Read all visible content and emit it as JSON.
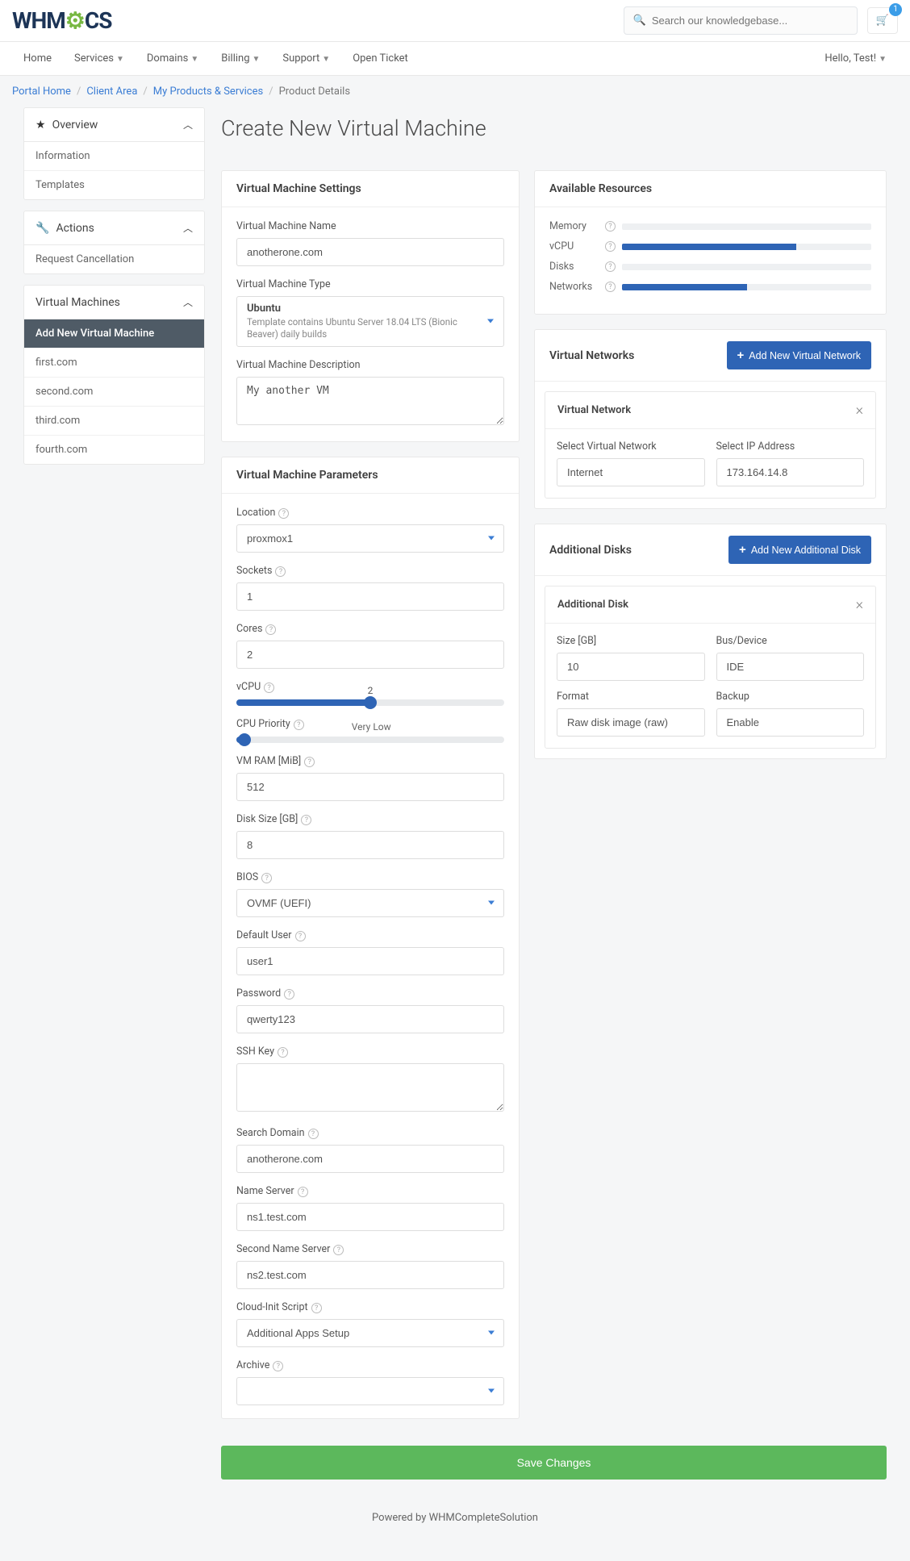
{
  "header": {
    "logo_text_1": "WHM",
    "logo_text_2": "CS",
    "search_placeholder": "Search our knowledgebase...",
    "cart_badge": "1"
  },
  "nav": {
    "items": [
      "Home",
      "Services",
      "Domains",
      "Billing",
      "Support",
      "Open Ticket"
    ],
    "dropdowns": [
      false,
      true,
      true,
      true,
      true,
      false
    ],
    "user_greeting": "Hello, Test!"
  },
  "breadcrumb": [
    "Portal Home",
    "Client Area",
    "My Products & Services",
    "Product Details"
  ],
  "sidebar": {
    "overview": {
      "title": "Overview",
      "items": [
        "Information",
        "Templates"
      ]
    },
    "actions": {
      "title": "Actions",
      "items": [
        "Request Cancellation"
      ]
    },
    "vms": {
      "title": "Virtual Machines",
      "items": [
        "Add New Virtual Machine",
        "first.com",
        "second.com",
        "third.com",
        "fourth.com"
      ],
      "active_index": 0
    }
  },
  "page_title": "Create New Virtual Machine",
  "vm_settings": {
    "title": "Virtual Machine Settings",
    "name_label": "Virtual Machine Name",
    "name_value": "anotherone.com",
    "type_label": "Virtual Machine Type",
    "type_title": "Ubuntu",
    "type_desc": "Template contains Ubuntu Server 18.04 LTS (Bionic Beaver) daily builds",
    "desc_label": "Virtual Machine Description",
    "desc_value": "My another VM"
  },
  "resources": {
    "title": "Available Resources",
    "rows": [
      {
        "label": "Memory",
        "fill": 0
      },
      {
        "label": "vCPU",
        "fill": 70
      },
      {
        "label": "Disks",
        "fill": 0
      },
      {
        "label": "Networks",
        "fill": 50
      }
    ]
  },
  "params": {
    "title": "Virtual Machine Parameters",
    "location_label": "Location",
    "location_value": "proxmox1",
    "sockets_label": "Sockets",
    "sockets_value": "1",
    "cores_label": "Cores",
    "cores_value": "2",
    "vcpu_label": "vCPU",
    "vcpu_value": "2",
    "vcpu_pct": 50,
    "priority_label": "CPU Priority",
    "priority_text": "Very Low",
    "priority_pct": 3,
    "ram_label": "VM RAM [MiB]",
    "ram_value": "512",
    "disk_label": "Disk Size [GB]",
    "disk_value": "8",
    "bios_label": "BIOS",
    "bios_value": "OVMF (UEFI)",
    "user_label": "Default User",
    "user_value": "user1",
    "pass_label": "Password",
    "pass_value": "qwerty123",
    "ssh_label": "SSH Key",
    "ssh_value": "",
    "search_domain_label": "Search Domain",
    "search_domain_value": "anotherone.com",
    "ns1_label": "Name Server",
    "ns1_value": "ns1.test.com",
    "ns2_label": "Second Name Server",
    "ns2_value": "ns2.test.com",
    "cloudinit_label": "Cloud-Init Script",
    "cloudinit_value": "Additional Apps Setup",
    "archive_label": "Archive",
    "archive_value": ""
  },
  "networks": {
    "title": "Virtual Networks",
    "add_btn": "Add New Virtual Network",
    "card_title": "Virtual Network",
    "select_net_label": "Select Virtual Network",
    "select_net_value": "Internet",
    "select_ip_label": "Select IP Address",
    "select_ip_value": "173.164.14.8"
  },
  "disks": {
    "title": "Additional Disks",
    "add_btn": "Add New Additional Disk",
    "card_title": "Additional Disk",
    "size_label": "Size [GB]",
    "size_value": "10",
    "bus_label": "Bus/Device",
    "bus_value": "IDE",
    "format_label": "Format",
    "format_value": "Raw disk image (raw)",
    "backup_label": "Backup",
    "backup_value": "Enable"
  },
  "save_btn": "Save Changes",
  "footer": "Powered by WHMCompleteSolution"
}
